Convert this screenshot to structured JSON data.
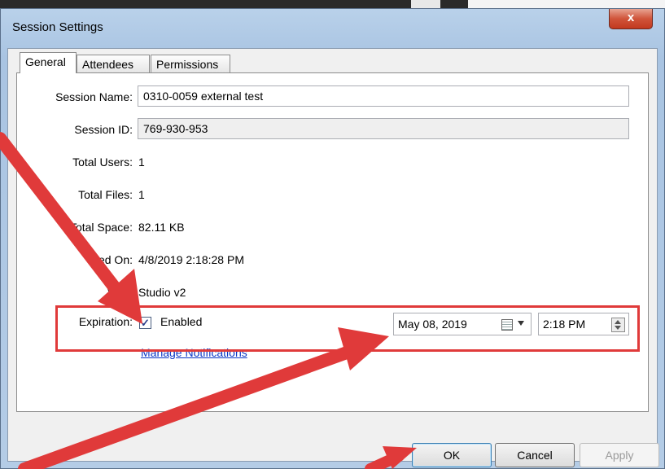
{
  "window": {
    "title": "Session Settings",
    "close_label": "x"
  },
  "tabs": [
    {
      "label": "General",
      "active": true
    },
    {
      "label": "Attendees",
      "active": false
    },
    {
      "label": "Permissions",
      "active": false
    }
  ],
  "general": {
    "session_name": {
      "label": "Session Name:",
      "value": "0310-0059 external test"
    },
    "session_id": {
      "label": "Session ID:",
      "value": "769-930-953"
    },
    "total_users": {
      "label": "Total Users:",
      "value": "1"
    },
    "total_files": {
      "label": "Total Files:",
      "value": "1"
    },
    "total_space": {
      "label": "Total Space:",
      "value": "82.11 KB"
    },
    "created_on": {
      "label": "ted On:",
      "value": "4/8/2019 2:18:28 PM"
    },
    "version": {
      "label": "Versi",
      "value": "Studio v2"
    },
    "expiration": {
      "label": "Expiration:",
      "checkbox_label": "Enabled",
      "checked": true,
      "date": "May 08, 2019",
      "time": "2:18 PM"
    },
    "manage_notifications": "Manage Notifications"
  },
  "buttons": {
    "ok": "OK",
    "cancel": "Cancel",
    "apply": "Apply"
  },
  "colors": {
    "annotation": "#e03a3a",
    "link": "#0b36c6"
  },
  "icons": [
    "calendar-icon",
    "spin-up-icon",
    "spin-down-icon",
    "close-icon",
    "check-icon"
  ]
}
